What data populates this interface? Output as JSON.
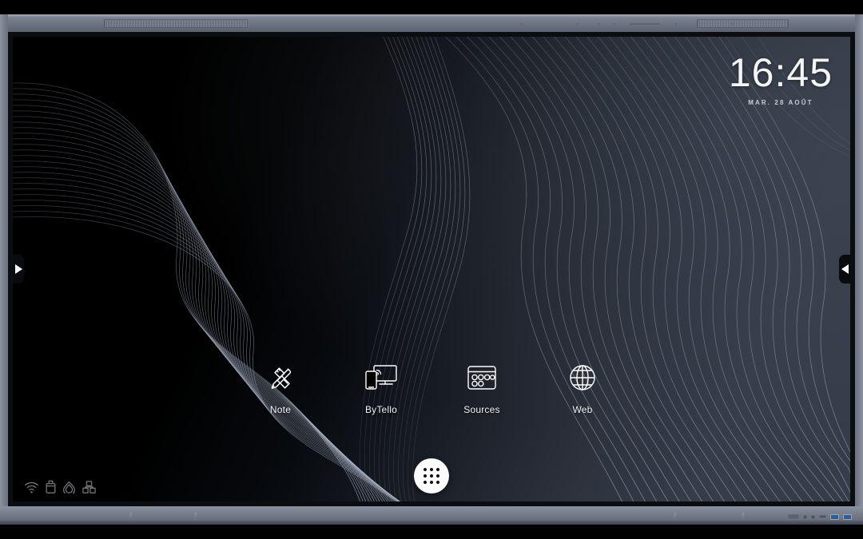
{
  "device": {
    "type": "interactive-flat-panel-display",
    "bezel_color": "#767d8b",
    "screen_bg": "#000000"
  },
  "clock": {
    "time": "16:45",
    "date": "MAR. 28 AOÛT",
    "time_color": "#f4f5f7",
    "date_color": "#c9ccd4"
  },
  "dock": {
    "apps": [
      {
        "label": "Note",
        "icon": "pen-ruler-icon"
      },
      {
        "label": "ByTello",
        "icon": "screen-cast-icon"
      },
      {
        "label": "Sources",
        "icon": "input-sources-icon"
      },
      {
        "label": "Web",
        "icon": "globe-icon"
      }
    ]
  },
  "app_drawer": {
    "name": "all-apps-button",
    "icon": "grid-dots-icon",
    "bg_color": "#fbfbfc"
  },
  "status_bar": {
    "icons": [
      {
        "name": "wifi-icon",
        "label": "Wi-Fi"
      },
      {
        "name": "usb-drive-icon",
        "label": "USB"
      },
      {
        "name": "cloud-drop-icon",
        "label": "Cloud"
      },
      {
        "name": "apps-blocks-icon",
        "label": "Apps"
      }
    ]
  },
  "side_handles": {
    "left": {
      "name": "left-side-toolbar-handle",
      "glyph": "▶"
    },
    "right": {
      "name": "right-side-toolbar-handle",
      "glyph": "◀"
    }
  },
  "wallpaper": {
    "style": "flowing-line-waves",
    "dark_color": "#000000",
    "light_color": "#343a47",
    "line_color": "#9aa3b4"
  }
}
